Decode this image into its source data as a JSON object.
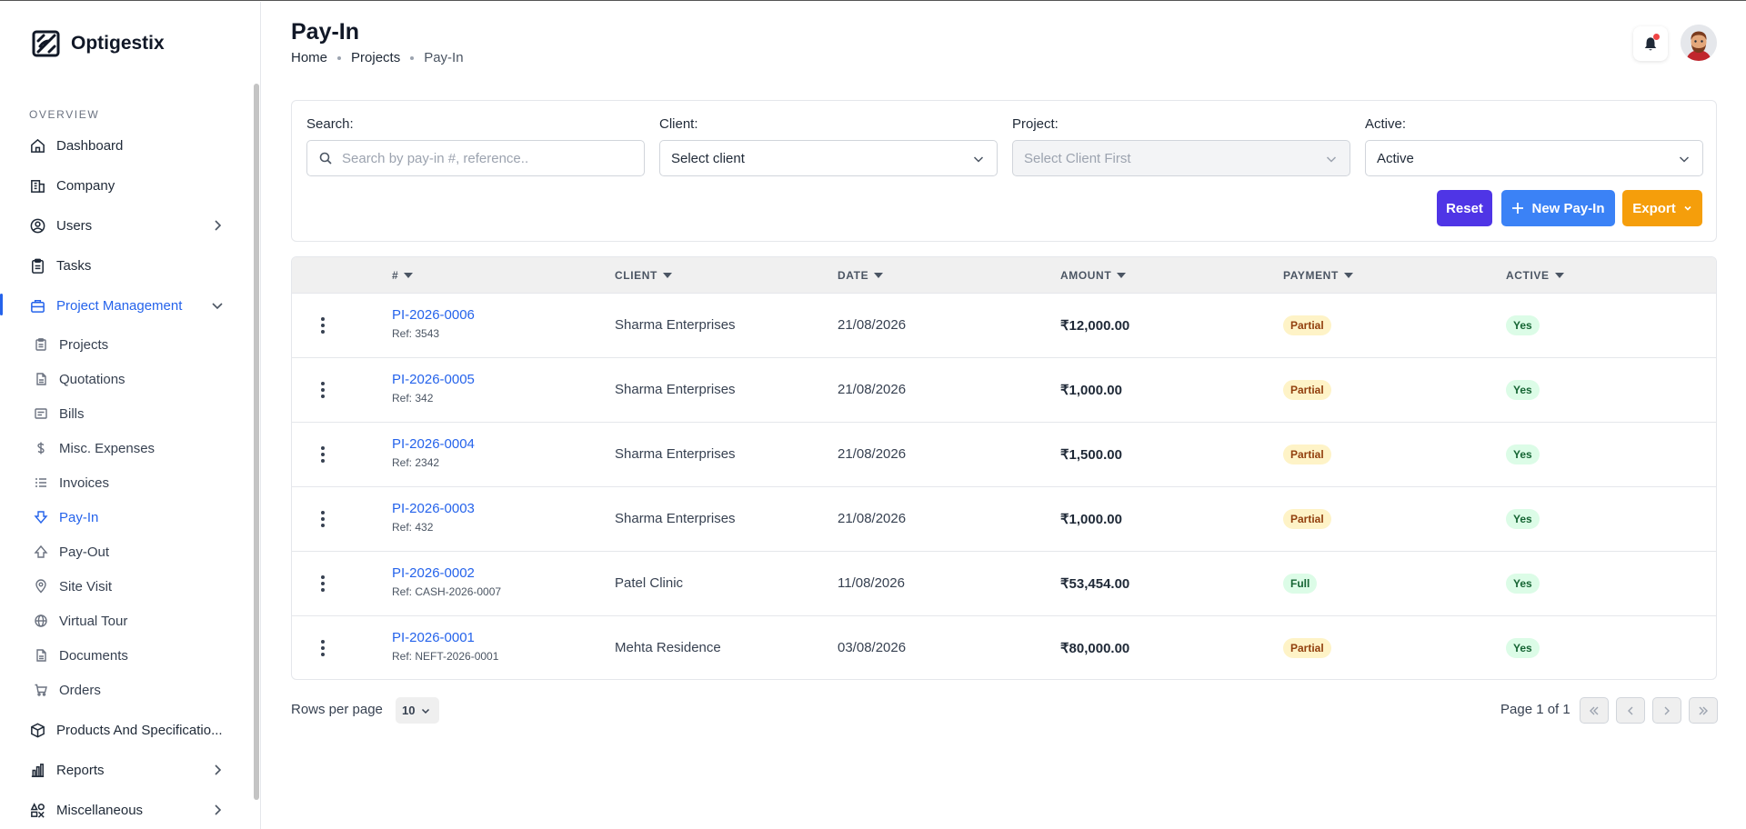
{
  "brand": {
    "name": "Optigestix"
  },
  "sidebar": {
    "section_label": "OVERVIEW",
    "items": [
      {
        "label": "Dashboard"
      },
      {
        "label": "Company"
      },
      {
        "label": "Users"
      },
      {
        "label": "Tasks"
      },
      {
        "label": "Project Management"
      },
      {
        "label": "Products And Specificatio..."
      },
      {
        "label": "Reports"
      },
      {
        "label": "Miscellaneous"
      }
    ],
    "sub_items": [
      {
        "label": "Projects"
      },
      {
        "label": "Quotations"
      },
      {
        "label": "Bills"
      },
      {
        "label": "Misc. Expenses"
      },
      {
        "label": "Invoices"
      },
      {
        "label": "Pay-In"
      },
      {
        "label": "Pay-Out"
      },
      {
        "label": "Site Visit"
      },
      {
        "label": "Virtual Tour"
      },
      {
        "label": "Documents"
      },
      {
        "label": "Orders"
      }
    ]
  },
  "header": {
    "title": "Pay-In",
    "breadcrumb": [
      "Home",
      "Projects",
      "Pay-In"
    ]
  },
  "filters": {
    "search_label": "Search:",
    "search_placeholder": "Search by pay-in #, reference..",
    "client_label": "Client:",
    "client_value": "Select client",
    "project_label": "Project:",
    "project_value": "Select Client First",
    "active_label": "Active:",
    "active_value": "Active",
    "reset_label": "Reset",
    "new_label": "New Pay-In",
    "export_label": "Export"
  },
  "table": {
    "columns": [
      "#",
      "CLIENT",
      "DATE",
      "AMOUNT",
      "PAYMENT",
      "ACTIVE"
    ],
    "rows": [
      {
        "id": "PI-2026-0006",
        "ref": "Ref: 3543",
        "client": "Sharma Enterprises",
        "date": "21/08/2026",
        "amount": "₹12,000.00",
        "payment": "Partial",
        "active": "Yes"
      },
      {
        "id": "PI-2026-0005",
        "ref": "Ref: 342",
        "client": "Sharma Enterprises",
        "date": "21/08/2026",
        "amount": "₹1,000.00",
        "payment": "Partial",
        "active": "Yes"
      },
      {
        "id": "PI-2026-0004",
        "ref": "Ref: 2342",
        "client": "Sharma Enterprises",
        "date": "21/08/2026",
        "amount": "₹1,500.00",
        "payment": "Partial",
        "active": "Yes"
      },
      {
        "id": "PI-2026-0003",
        "ref": "Ref: 432",
        "client": "Sharma Enterprises",
        "date": "21/08/2026",
        "amount": "₹1,000.00",
        "payment": "Partial",
        "active": "Yes"
      },
      {
        "id": "PI-2026-0002",
        "ref": "Ref: CASH-2026-0007",
        "client": "Patel Clinic",
        "date": "11/08/2026",
        "amount": "₹53,454.00",
        "payment": "Full",
        "active": "Yes"
      },
      {
        "id": "PI-2026-0001",
        "ref": "Ref: NEFT-2026-0001",
        "client": "Mehta Residence",
        "date": "03/08/2026",
        "amount": "₹80,000.00",
        "payment": "Partial",
        "active": "Yes"
      }
    ]
  },
  "footer": {
    "rows_label": "Rows per page",
    "rows_value": "10",
    "page_info": "Page 1 of 1"
  },
  "colors": {
    "accent": "#2563eb",
    "reset": "#4f35e6",
    "new": "#3b82f6",
    "export": "#f59e0b",
    "partial_bg": "#fef3c7",
    "full_bg": "#dcfce7"
  }
}
